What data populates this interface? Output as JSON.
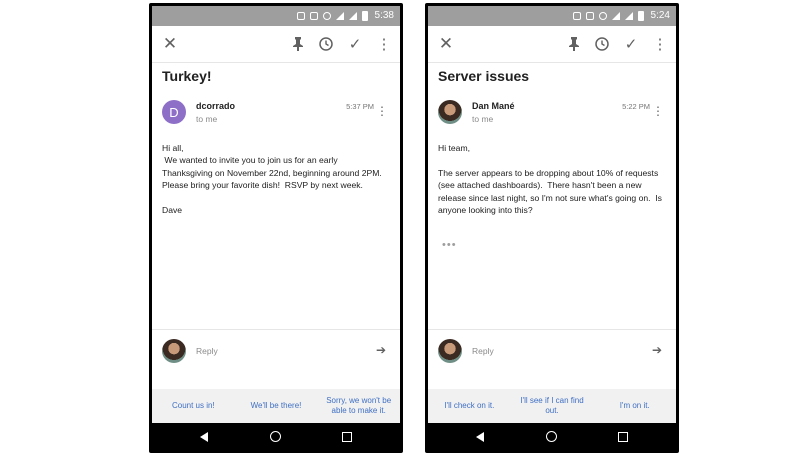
{
  "phones": [
    {
      "status": {
        "time": "5:38"
      },
      "subject": "Turkey!",
      "sender": "dcorrado",
      "avatar_letter": "D",
      "to": "to me",
      "time": "5:37 PM",
      "body": "Hi all,\n We wanted to invite you to join us for an early Thanksgiving on November 22nd, beginning around 2PM.  Please bring your favorite dish!  RSVP by next week.\n\nDave",
      "reply_placeholder": "Reply",
      "smart_replies": [
        "Count us in!",
        "We'll be there!",
        "Sorry, we won't be able to make it."
      ]
    },
    {
      "status": {
        "time": "5:24"
      },
      "subject": "Server issues",
      "sender": "Dan Mané",
      "to": "to me",
      "time": "5:22 PM",
      "body": "Hi team,\n\nThe server appears to be dropping about 10% of requests (see attached dashboards).  There hasn't been a new release since last night, so I'm not sure what's going on.  Is anyone looking into this?",
      "ellipsis": "•••",
      "reply_placeholder": "Reply",
      "smart_replies": [
        "I'll check on it.",
        "I'll see if I can find out.",
        "I'm on it."
      ]
    }
  ],
  "icons": {
    "close": "✕",
    "pin": "📌",
    "clock": "◷",
    "check": "✓",
    "more": "⋮",
    "send": "➔"
  }
}
